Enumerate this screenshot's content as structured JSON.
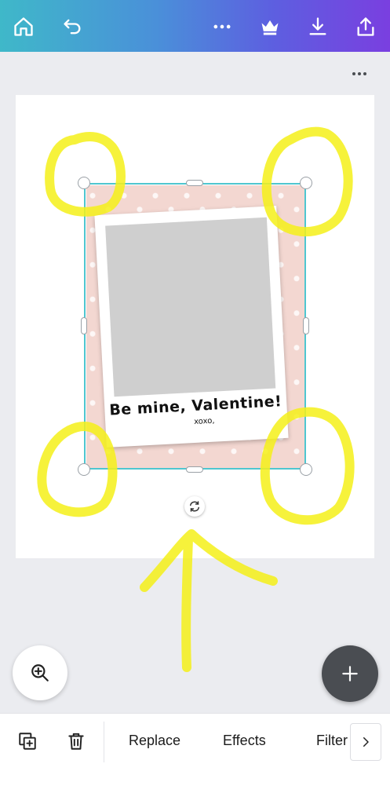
{
  "header": {
    "icons": [
      "home-icon",
      "undo-icon",
      "more-icon",
      "crown-icon",
      "download-icon",
      "share-icon"
    ]
  },
  "canvas": {
    "caption": "Be mine, Valentine!",
    "signoff": "xoxo,",
    "frame_color": "#f3d7d1",
    "selection_color": "#4fc6d0",
    "annotation_color": "#f5f019"
  },
  "toolbar": {
    "replace_label": "Replace",
    "effects_label": "Effects",
    "filter_label": "Filter"
  }
}
